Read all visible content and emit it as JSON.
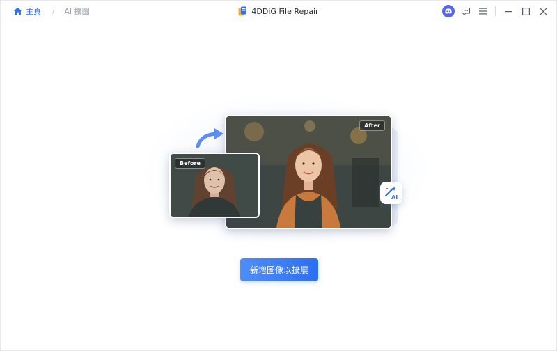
{
  "app": {
    "title": "4DDiG File Repair"
  },
  "breadcrumb": {
    "home_label": "主頁",
    "separator": "/",
    "current_label": "AI 擴圖"
  },
  "window_controls": {
    "icons": [
      "discord-icon",
      "feedback-icon",
      "menu-icon",
      "minimize-icon",
      "maximize-icon",
      "close-icon"
    ]
  },
  "illustration": {
    "before_label": "Before",
    "after_label": "After",
    "badge_text": "AI"
  },
  "main": {
    "add_button_label": "新增圖像以擴展"
  },
  "colors": {
    "accent": "#2f6ff3",
    "button_start": "#4f8ef8",
    "button_end": "#2b6ff2",
    "discord": "#5865f2"
  }
}
